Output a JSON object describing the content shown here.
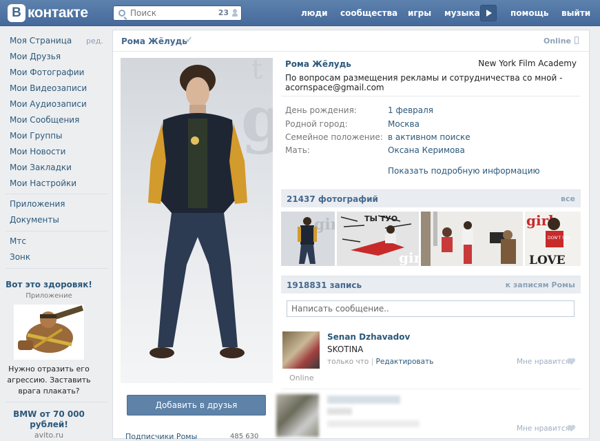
{
  "topbar": {
    "logo_letter": "B",
    "logo_text": "контакте",
    "search_placeholder": "Поиск",
    "search_count": "23",
    "nav": [
      "люди",
      "сообщества",
      "игры",
      "музыка",
      "помощь",
      "выйти"
    ]
  },
  "sidebar": {
    "items": [
      "Моя Страница",
      "Мои Друзья",
      "Мои Фотографии",
      "Мои Видеозаписи",
      "Мои Аудиозаписи",
      "Мои Сообщения",
      "Мои Группы",
      "Мои Новости",
      "Мои Закладки",
      "Мои Настройки"
    ],
    "edit_label": "ред.",
    "apps": [
      "Приложения",
      "Документы"
    ],
    "extra": [
      "Мтс",
      "Зонк"
    ],
    "ad1": {
      "title": "Вот это здоровяк!",
      "subtitle": "Приложение",
      "text": "Нужно отразить его агрессию. Заставить врага плакать?"
    },
    "ad2": {
      "title": "BMW от 70 000 рублей!",
      "domain": "avito.ru"
    }
  },
  "header": {
    "name": "Рома Жёлудь",
    "online": "Online"
  },
  "profile": {
    "name": "Рома Жёлудь",
    "school": "New York Film Academy",
    "status": "По вопросам размещения рекламы и сотрудничества со мной - acornspace@gmail.com",
    "info": [
      {
        "label": "День рождения:",
        "value": "1 февраля"
      },
      {
        "label": "Родной город:",
        "value": "Москва"
      },
      {
        "label": "Семейное положение:",
        "value": "в активном поиске"
      },
      {
        "label": "Мать:",
        "value": "Оксана Керимова"
      }
    ],
    "more_label": "Показать подробную информацию",
    "add_friend_label": "Добавить в друзья",
    "subscribers_label": "Подписчики Ромы",
    "subscribers_count": "485 630"
  },
  "photos": {
    "title": "21437 фотографий",
    "all_label": "все"
  },
  "wall": {
    "title": "1918831 запись",
    "link_label": "к записям Ромы",
    "input_placeholder": "Написать сообщение..",
    "post": {
      "author": "Senan Dzhavadov",
      "text": "SKOTINA",
      "time": "только что",
      "edit": "Редактировать",
      "like": "Мне нравится",
      "online": "Online"
    },
    "like2": "Мне нравится"
  },
  "colors": {
    "topbar": "#5d82ae",
    "link": "#2b587a",
    "button": "#5e82a8"
  }
}
